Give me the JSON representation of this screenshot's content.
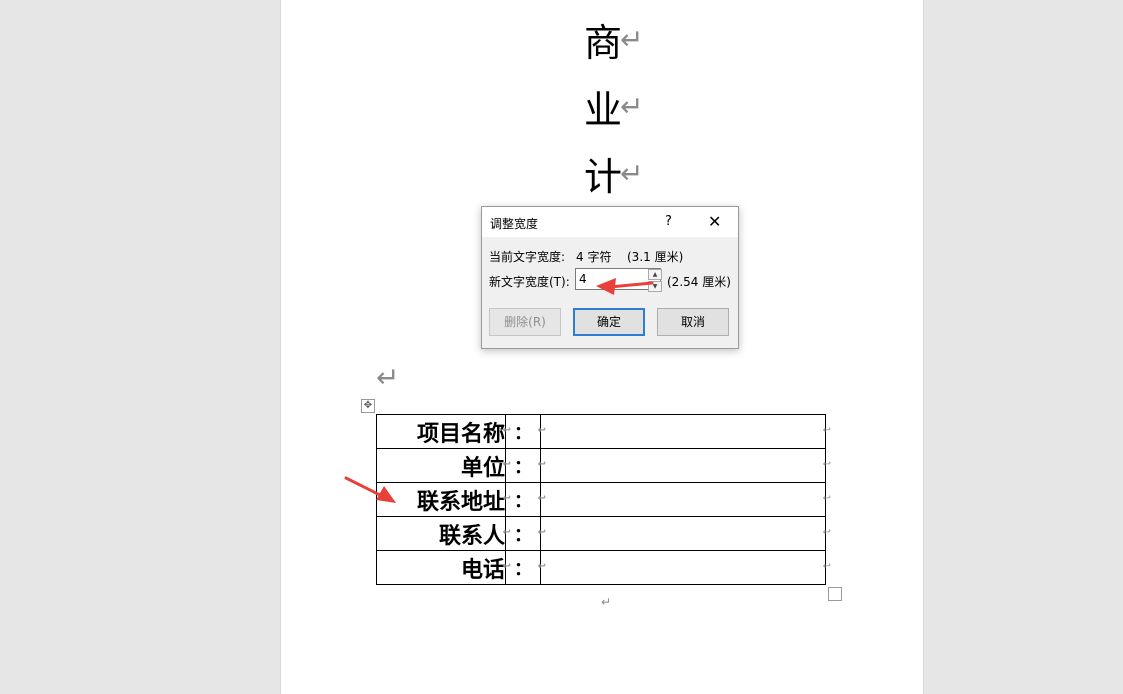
{
  "document": {
    "title_chars": [
      "商",
      "业",
      "计"
    ],
    "table_rows": [
      {
        "label": "项目名称",
        "colon": "：",
        "value": ""
      },
      {
        "label": "单位",
        "colon": "：",
        "value": ""
      },
      {
        "label": "联系地址",
        "colon": "：",
        "value": ""
      },
      {
        "label": "联系人",
        "colon": "：",
        "value": ""
      },
      {
        "label": "电话",
        "colon": "：",
        "value": ""
      }
    ],
    "paragraph_mark": "↵",
    "cell_mark": "↩"
  },
  "dialog": {
    "title": "调整宽度",
    "help": "?",
    "close": "✕",
    "current_label": "当前文字宽度:",
    "current_chars": "4 字符",
    "current_cm": "(3.1 厘米)",
    "new_label": "新文字宽度(T):",
    "new_value": "4",
    "new_cm": "(2.54 厘米)",
    "delete_button": "删除(R)",
    "ok_button": "确定",
    "cancel_button": "取消"
  },
  "annotation": {
    "arrow_color": "#e8403a"
  }
}
